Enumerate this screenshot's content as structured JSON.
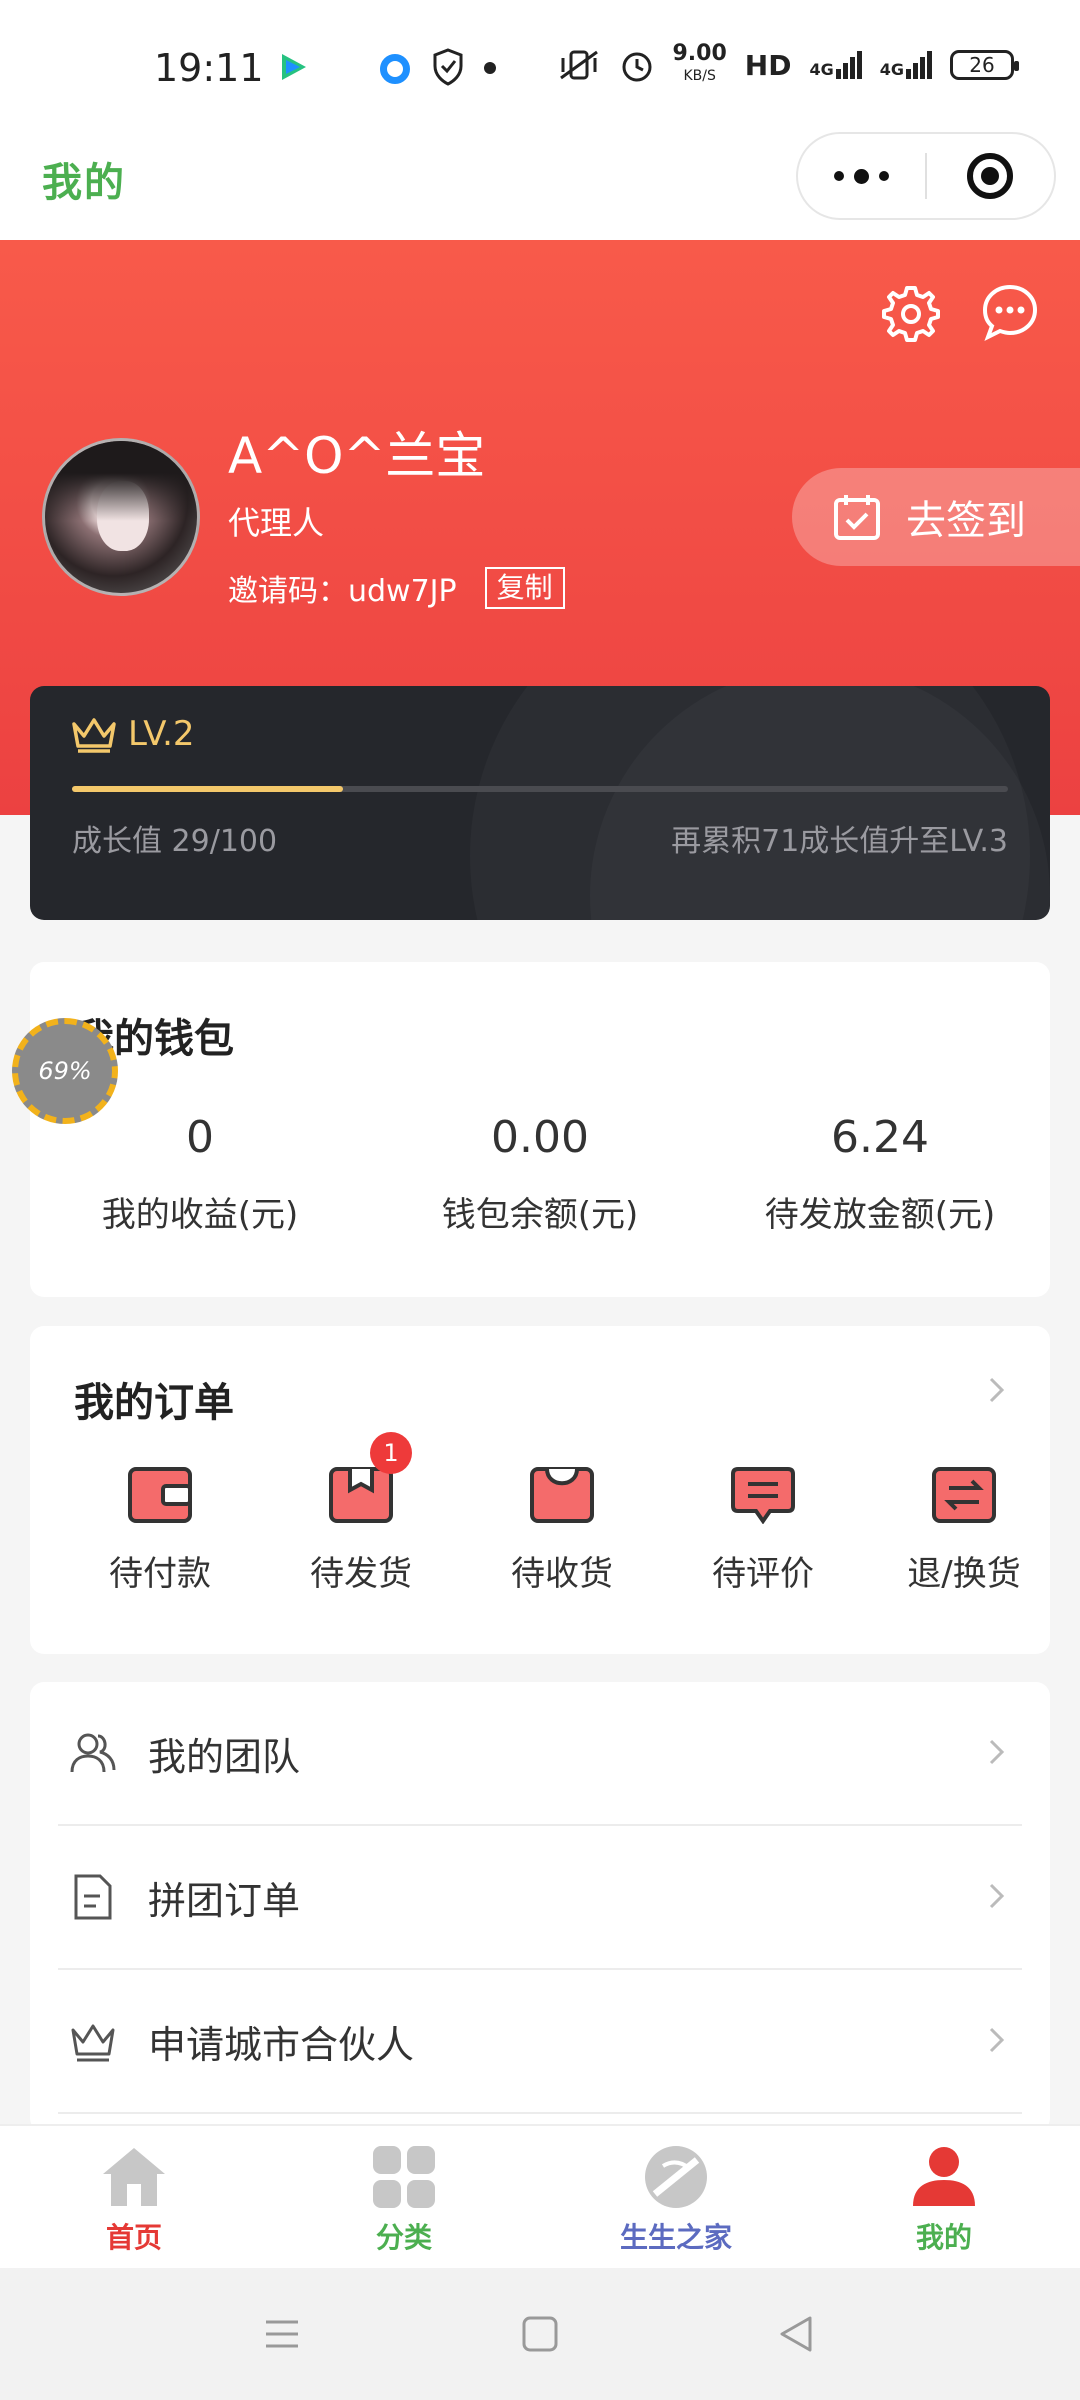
{
  "status_bar": {
    "time": "19:11",
    "net_speed": "9.00",
    "net_unit": "KB/S",
    "hd": "HD",
    "sig1": "4G",
    "sig2": "4G",
    "battery": "26"
  },
  "titlebar": {
    "title": "我的"
  },
  "profile": {
    "name": "A^O^兰宝",
    "role": "代理人",
    "invite_label": "邀请码：udw7JP",
    "copy_label": "复制",
    "signin_label": "去签到"
  },
  "level": {
    "level_label": "LV.2",
    "growth_text": "成长值 29/100",
    "progress_fraction": 0.29,
    "next_text": "再累积71成长值升至LV.3"
  },
  "wallet": {
    "title": "我的钱包",
    "items": [
      {
        "value": "0",
        "label": "我的收益(元)"
      },
      {
        "value": "0.00",
        "label": "钱包余额(元)"
      },
      {
        "value": "6.24",
        "label": "待发放金额(元)"
      }
    ]
  },
  "float_widget": {
    "percent": "69%"
  },
  "orders": {
    "title": "我的订单",
    "items": [
      {
        "label": "待付款",
        "icon": "wallet-icon"
      },
      {
        "label": "待发货",
        "icon": "box-icon",
        "badge": "1"
      },
      {
        "label": "待收货",
        "icon": "bag-icon"
      },
      {
        "label": "待评价",
        "icon": "comment-icon"
      },
      {
        "label": "退/换货",
        "icon": "exchange-icon"
      }
    ]
  },
  "menu": {
    "items": [
      {
        "label": "我的团队",
        "icon": "team-icon"
      },
      {
        "label": "拼团订单",
        "icon": "document-icon"
      },
      {
        "label": "申请城市合伙人",
        "icon": "crown-icon"
      }
    ]
  },
  "tabbar": {
    "items": [
      {
        "label": "首页",
        "icon": "home-icon"
      },
      {
        "label": "分类",
        "icon": "grid-icon"
      },
      {
        "label": "生生之家",
        "icon": "planet-icon"
      },
      {
        "label": "我的",
        "icon": "user-icon"
      }
    ],
    "colors": {
      "active": "#e53935",
      "inactive": "#c7c7c7"
    }
  },
  "theme": {
    "accent": "#ec4141",
    "gold": "#f4c86b"
  }
}
